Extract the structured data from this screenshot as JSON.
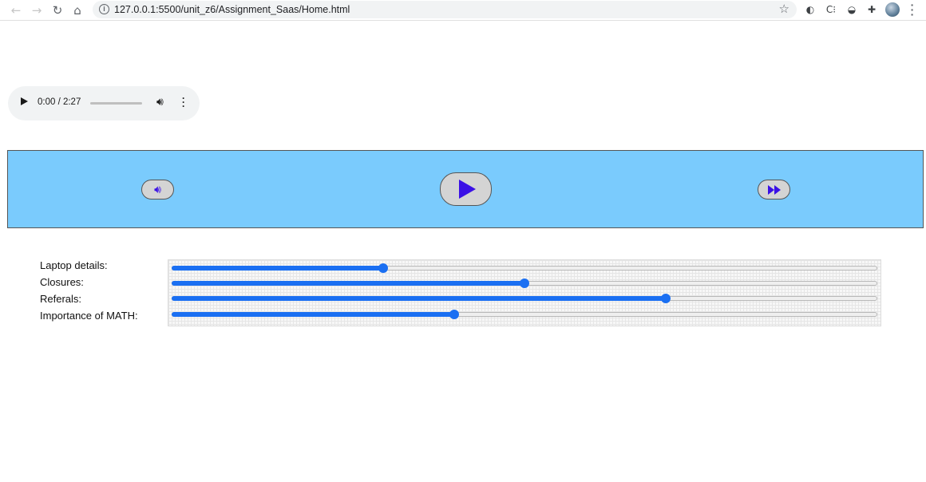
{
  "browser": {
    "url": "127.0.0.1:5500/unit_z6/Assignment_Saas/Home.html",
    "back_icon": "arrow-left-icon",
    "forward_icon": "arrow-right-icon",
    "reload_icon": "reload-icon",
    "home_icon": "home-icon"
  },
  "audio": {
    "time": "0:00 / 2:27",
    "progress": 0
  },
  "panel": {
    "background": "#7acbfd",
    "icon_color": "#3a10e6",
    "volume_icon": "volume-icon",
    "play_icon": "play-icon",
    "fast_forward_icon": "fast-forward-icon"
  },
  "sliders": [
    {
      "label": "Laptop details:",
      "value": 0.3
    },
    {
      "label": "Closures:",
      "value": 0.5
    },
    {
      "label": "Referals:",
      "value": 0.7
    },
    {
      "label": "Importance of MATH:",
      "value": 0.4
    }
  ]
}
